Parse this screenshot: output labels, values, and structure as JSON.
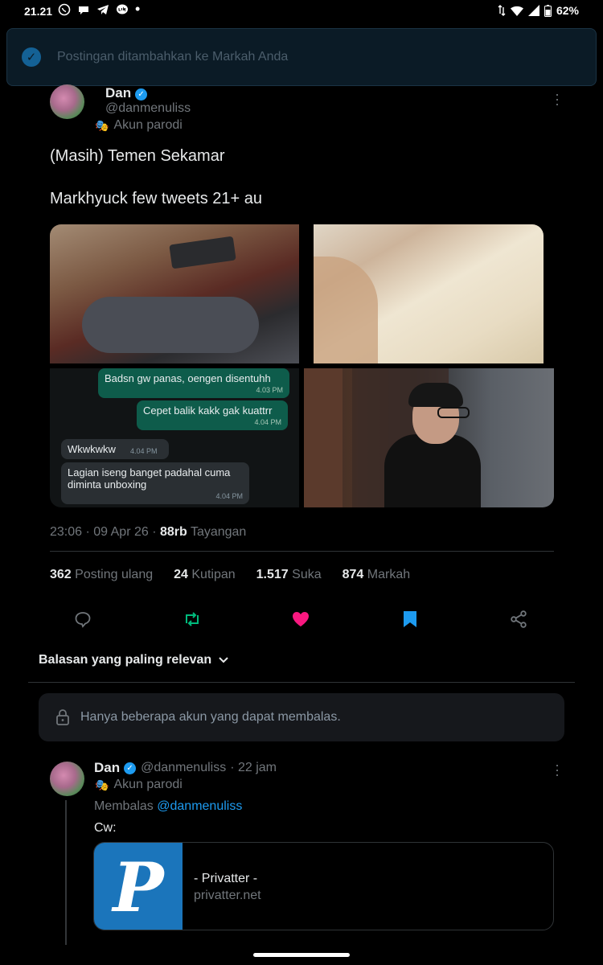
{
  "status_bar": {
    "time": "21.21",
    "battery": "62%",
    "notification_icons": [
      "whatsapp-icon",
      "chat-icon",
      "telegram-icon",
      "line-icon"
    ]
  },
  "toast": {
    "message": "Postingan ditambahkan ke Markah Anda"
  },
  "post": {
    "author_name": "Dan",
    "author_handle": "@danmenuliss",
    "parody_label": "Akun parodi",
    "text_line1": "(Masih) Temen Sekamar",
    "text_line2": "Markhyuck few tweets 21+ au",
    "chat": {
      "out1": {
        "text": "Badsn gw panas, oengen disentuhh",
        "time": "4.03 PM"
      },
      "out2": {
        "text": "Cepet balik kakk gak kuattrr",
        "time": "4.04 PM"
      },
      "in1": {
        "text": "Wkwkwkw",
        "time": "4.04 PM"
      },
      "in2": {
        "text": "Lagian iseng banget padahal cuma diminta unboxing",
        "time": "4.04 PM"
      }
    },
    "timestamp": "23:06 · 09 Apr 26 · ",
    "views_count": "88rb",
    "views_label": "Tayangan",
    "stats": {
      "reposts_count": "362",
      "reposts_label": "Posting ulang",
      "quotes_count": "24",
      "quotes_label": "Kutipan",
      "likes_count": "1.517",
      "likes_label": "Suka",
      "bookmarks_count": "874",
      "bookmarks_label": "Markah"
    }
  },
  "replies": {
    "sort_label": "Balasan yang paling relevan",
    "limit_notice": "Hanya beberapa akun yang dapat membalas."
  },
  "reply": {
    "author_name": "Dan",
    "author_handle": "@danmenuliss",
    "time": "· 22 jam",
    "parody_label": "Akun parodi",
    "replying_to_prefix": "Membalas",
    "replying_to_handle": "@danmenuliss",
    "text": "Cw:",
    "card": {
      "logo_letter": "P",
      "title": "- Privatter -",
      "domain": "privatter.net"
    }
  },
  "colors": {
    "accent": "#1d9bf0",
    "repost": "#00ba7c",
    "like": "#f91880",
    "background": "#000000"
  }
}
